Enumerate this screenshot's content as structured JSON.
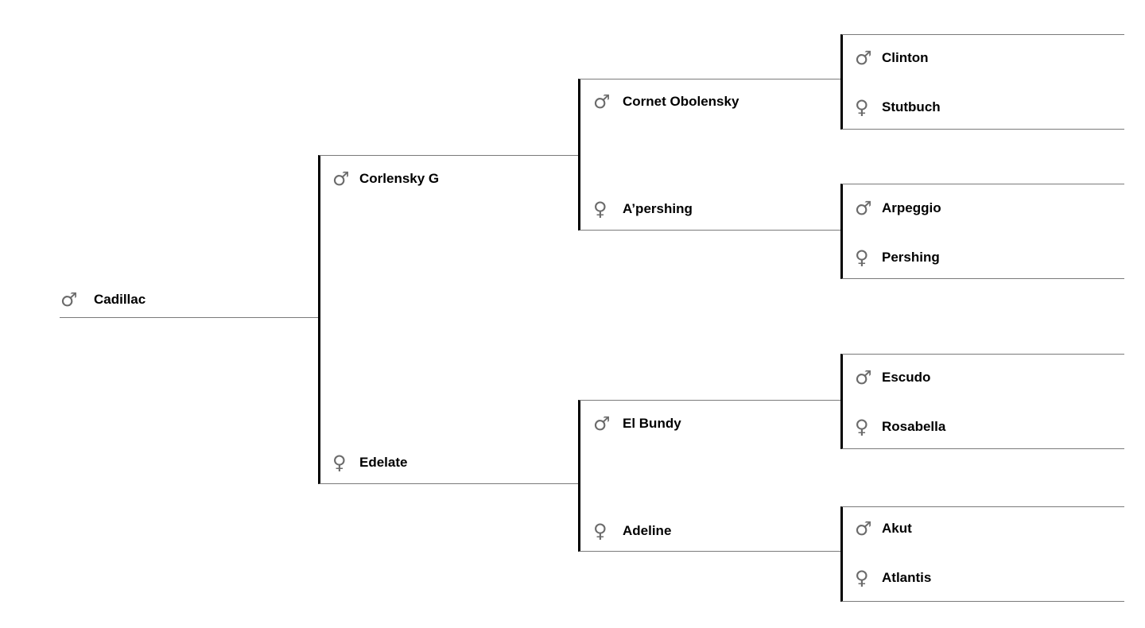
{
  "icons": {
    "male": "♂",
    "female": "♀",
    "male_name": "male-icon",
    "female_name": "female-icon",
    "icon_color": "#6b6b6b"
  },
  "pedigree": {
    "subject": {
      "name": "Cadillac",
      "sex": "male"
    },
    "sire": {
      "name": "Corlensky G",
      "sex": "male"
    },
    "dam": {
      "name": "Edelate",
      "sex": "female"
    },
    "sire_sire": {
      "name": "Cornet Obolensky",
      "sex": "male"
    },
    "sire_dam": {
      "name": "A’pershing",
      "sex": "female"
    },
    "dam_sire": {
      "name": "El Bundy",
      "sex": "male"
    },
    "dam_dam": {
      "name": "Adeline",
      "sex": "female"
    },
    "sss": {
      "name": "Clinton",
      "sex": "male"
    },
    "ssd": {
      "name": "Stutbuch",
      "sex": "female"
    },
    "sds": {
      "name": "Arpeggio",
      "sex": "male"
    },
    "sdd": {
      "name": "Pershing",
      "sex": "female"
    },
    "dss": {
      "name": "Escudo",
      "sex": "male"
    },
    "dsd": {
      "name": "Rosabella",
      "sex": "female"
    },
    "dds": {
      "name": "Akut",
      "sex": "male"
    },
    "ddd": {
      "name": "Atlantis",
      "sex": "female"
    }
  }
}
